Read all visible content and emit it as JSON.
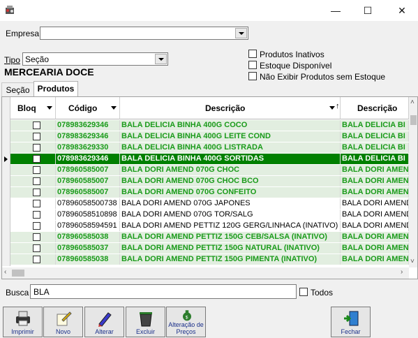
{
  "window": {
    "minimize_glyph": "—",
    "maximize_glyph": "☐",
    "close_glyph": "✕"
  },
  "filters": {
    "empresa_label": "Empresa",
    "empresa_value": "",
    "tipo_label": "Tipo",
    "tipo_value": "Seção",
    "section_title": "MERCEARIA DOCE",
    "options": [
      {
        "label": "Produtos Inativos",
        "checked": false
      },
      {
        "label": "Estoque Disponível",
        "checked": false
      },
      {
        "label": "Não Exibir Produtos sem Estoque",
        "checked": false
      }
    ]
  },
  "tabs": [
    {
      "label": "Seção",
      "active": false
    },
    {
      "label": "Produtos",
      "active": true
    }
  ],
  "grid": {
    "columns": [
      "Bloq",
      "Código",
      "Descrição",
      "Descrição"
    ],
    "rows": [
      {
        "bloq": false,
        "codigo": "078983629346",
        "descricao": "BALA DELICIA BINHA 400G COCO",
        "descricao2": "BALA DELICIA BI",
        "style": "green"
      },
      {
        "bloq": false,
        "codigo": "078983629346",
        "descricao": "BALA DELICIA BINHA 400G LEITE COND",
        "descricao2": "BALA DELICIA BI",
        "style": "green"
      },
      {
        "bloq": false,
        "codigo": "078983629330",
        "descricao": "BALA DELICIA BINHA 400G LISTRADA",
        "descricao2": "BALA DELICIA BI",
        "style": "green"
      },
      {
        "bloq": false,
        "codigo": "078983629346",
        "descricao": "BALA DELICIA BINHA 400G SORTIDAS",
        "descricao2": "BALA DELICIA BI",
        "style": "selected"
      },
      {
        "bloq": false,
        "codigo": "078960585007",
        "descricao": "BALA DORI AMEND 070G CHOC",
        "descricao2": "BALA DORI AMEN",
        "style": "green"
      },
      {
        "bloq": false,
        "codigo": "078960585007",
        "descricao": "BALA DORI AMEND 070G CHOC BCO",
        "descricao2": "BALA DORI AMEN",
        "style": "green"
      },
      {
        "bloq": false,
        "codigo": "078960585007",
        "descricao": "BALA DORI AMEND 070G CONFEITO",
        "descricao2": "BALA DORI AMEN",
        "style": "green"
      },
      {
        "bloq": false,
        "codigo": "07896058500738",
        "descricao": "BALA DORI AMEND 070G JAPONES",
        "descricao2": "BALA DORI AMEND",
        "style": "normal"
      },
      {
        "bloq": false,
        "codigo": "07896058510898",
        "descricao": "BALA DORI AMEND 070G TOR/SALG",
        "descricao2": "BALA DORI AMEND",
        "style": "normal"
      },
      {
        "bloq": false,
        "codigo": "07896058594591",
        "descricao": "BALA DORI AMEND PETTIZ 120G GERG/LINHACA (INATIVO)",
        "descricao2": "BALA DORI AMEND",
        "style": "normal"
      },
      {
        "bloq": false,
        "codigo": "078960585038",
        "descricao": "BALA DORI AMEND PETTIZ 150G CEB/SALSA (INATIVO)",
        "descricao2": "BALA DORI AMEN",
        "style": "green"
      },
      {
        "bloq": false,
        "codigo": "078960585037",
        "descricao": "BALA DORI AMEND PETTIZ 150G NATURAL (INATIVO)",
        "descricao2": "BALA DORI AMEN",
        "style": "green"
      },
      {
        "bloq": false,
        "codigo": "078960585038",
        "descricao": "BALA DORI AMEND PETTIZ 150G PIMENTA (INATIVO)",
        "descricao2": "BALA DORI AMEN",
        "style": "green"
      }
    ]
  },
  "search": {
    "label": "Busca",
    "value": "BLA",
    "todos_label": "Todos"
  },
  "toolbar": [
    {
      "label": "Imprimir",
      "icon": "printer-icon"
    },
    {
      "label": "Novo",
      "icon": "new-pencil-icon"
    },
    {
      "label": "Alterar",
      "icon": "edit-pen-icon"
    },
    {
      "label": "Excluir",
      "icon": "trash-icon"
    },
    {
      "label": "Alteração de Preços",
      "icon": "money-bag-icon"
    },
    {
      "label": "Fechar",
      "icon": "exit-door-icon"
    }
  ],
  "colors": {
    "green_text": "#1a9b1a",
    "green_bg": "#e2eee0",
    "selected_bg": "#008000",
    "selected_text": "#ffffff",
    "caption_blue": "#1a2f8a"
  }
}
